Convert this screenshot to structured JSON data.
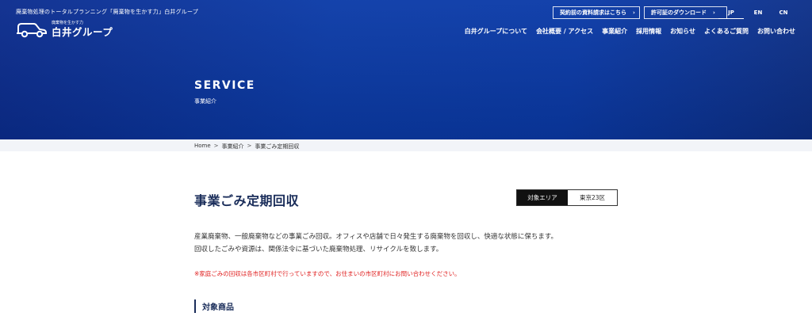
{
  "header": {
    "tagline": "廃棄物処理のトータルプランニング「廃棄物を生かす力」白井グループ",
    "logo_small": "廃棄物を生かす力",
    "logo_main": "白井グループ",
    "top_buttons": [
      {
        "label": "契約前の資料請求はこちら",
        "arrow": "›"
      },
      {
        "label": "許可証のダウンロード",
        "arrow": "›"
      }
    ],
    "languages": [
      "JP",
      "EN",
      "CN"
    ],
    "nav": [
      "白井グループについて",
      "会社概要 / アクセス",
      "事業紹介",
      "採用情報",
      "お知らせ",
      "よくあるご質問",
      "お問い合わせ"
    ]
  },
  "hero": {
    "title": "SERVICE",
    "subtitle": "事業紹介"
  },
  "breadcrumb": [
    "Home",
    "事業紹介",
    "事業ごみ定期回収"
  ],
  "breadcrumb_separator": ">",
  "main": {
    "title": "事業ごみ定期回収",
    "area_label": "対象エリア",
    "area_value": "東京23区",
    "description": [
      "産業廃棄物、一般廃棄物などの事業ごみ回収。オフィスや店舗で日々発生する廃棄物を回収し、快適な状態に保ちます。",
      "回収したごみや資源は、関係法令に基づいた廃棄物処理、リサイクルを致します。"
    ],
    "note": "※家庭ごみの回収は各市区町村で行っていますので、お住まいの市区町村にお問い合わせください。",
    "section_heading": "対象商品"
  },
  "colors": {
    "hero_blue": "#0b3ba8",
    "title_navy": "#1a2d5a",
    "note_red": "#e02020"
  }
}
